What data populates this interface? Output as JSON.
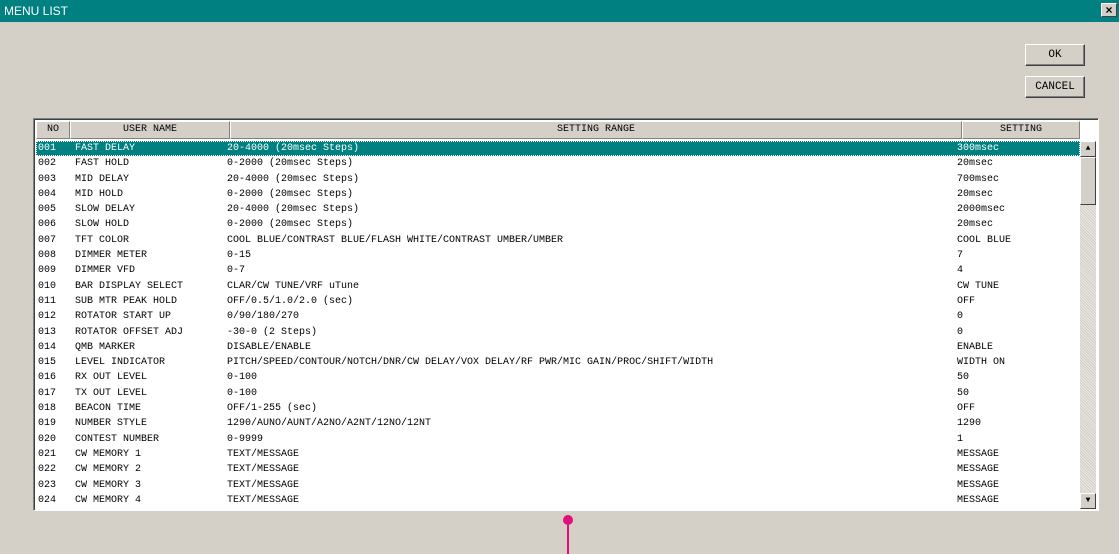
{
  "window": {
    "title": "MENU LIST",
    "close_glyph": "×"
  },
  "buttons": {
    "ok": "OK",
    "cancel": "CANCEL"
  },
  "table": {
    "headers": {
      "no": "NO",
      "name": "USER NAME",
      "range": "SETTING RANGE",
      "setting": "SETTING"
    },
    "rows": [
      {
        "no": "001",
        "name": "FAST DELAY",
        "range": "20-4000 (20msec Steps)",
        "setting": "300msec"
      },
      {
        "no": "002",
        "name": "FAST HOLD",
        "range": "0-2000 (20msec Steps)",
        "setting": "20msec"
      },
      {
        "no": "003",
        "name": "MID DELAY",
        "range": "20-4000 (20msec Steps)",
        "setting": "700msec"
      },
      {
        "no": "004",
        "name": "MID HOLD",
        "range": "0-2000 (20msec Steps)",
        "setting": "20msec"
      },
      {
        "no": "005",
        "name": "SLOW DELAY",
        "range": "20-4000 (20msec Steps)",
        "setting": "2000msec"
      },
      {
        "no": "006",
        "name": "SLOW HOLD",
        "range": "0-2000 (20msec Steps)",
        "setting": "20msec"
      },
      {
        "no": "007",
        "name": "TFT COLOR",
        "range": "COOL BLUE/CONTRAST BLUE/FLASH WHITE/CONTRAST UMBER/UMBER",
        "setting": "COOL BLUE"
      },
      {
        "no": "008",
        "name": "DIMMER METER",
        "range": "0-15",
        "setting": "7"
      },
      {
        "no": "009",
        "name": "DIMMER VFD",
        "range": "0-7",
        "setting": "4"
      },
      {
        "no": "010",
        "name": "BAR DISPLAY SELECT",
        "range": "CLAR/CW TUNE/VRF uTune",
        "setting": "CW TUNE"
      },
      {
        "no": "011",
        "name": "SUB MTR PEAK HOLD",
        "range": "OFF/0.5/1.0/2.0 (sec)",
        "setting": "OFF"
      },
      {
        "no": "012",
        "name": "ROTATOR START UP",
        "range": "0/90/180/270",
        "setting": "0"
      },
      {
        "no": "013",
        "name": "ROTATOR OFFSET ADJ",
        "range": "-30-0 (2 Steps)",
        "setting": "0"
      },
      {
        "no": "014",
        "name": "QMB MARKER",
        "range": "DISABLE/ENABLE",
        "setting": "ENABLE"
      },
      {
        "no": "015",
        "name": "LEVEL INDICATOR",
        "range": "PITCH/SPEED/CONTOUR/NOTCH/DNR/CW DELAY/VOX DELAY/RF PWR/MIC GAIN/PROC/SHIFT/WIDTH",
        "setting": "WIDTH ON"
      },
      {
        "no": "016",
        "name": "RX OUT LEVEL",
        "range": "0-100",
        "setting": "50"
      },
      {
        "no": "017",
        "name": "TX OUT LEVEL",
        "range": "0-100",
        "setting": "50"
      },
      {
        "no": "018",
        "name": "BEACON TIME",
        "range": "OFF/1-255 (sec)",
        "setting": "OFF"
      },
      {
        "no": "019",
        "name": "NUMBER STYLE",
        "range": "1290/AUNO/AUNT/A2NO/A2NT/12NO/12NT",
        "setting": "1290"
      },
      {
        "no": "020",
        "name": "CONTEST NUMBER",
        "range": "0-9999",
        "setting": "1"
      },
      {
        "no": "021",
        "name": "CW MEMORY 1",
        "range": "TEXT/MESSAGE",
        "setting": "MESSAGE"
      },
      {
        "no": "022",
        "name": "CW MEMORY 2",
        "range": "TEXT/MESSAGE",
        "setting": "MESSAGE"
      },
      {
        "no": "023",
        "name": "CW MEMORY 3",
        "range": "TEXT/MESSAGE",
        "setting": "MESSAGE"
      },
      {
        "no": "024",
        "name": "CW MEMORY 4",
        "range": "TEXT/MESSAGE",
        "setting": "MESSAGE"
      }
    ],
    "selected_row": 0
  },
  "scrollbar": {
    "up_glyph": "▲",
    "down_glyph": "▼"
  },
  "colors": {
    "titlebar": "#008080",
    "selection": "#008080",
    "marker": "#e0107a"
  },
  "icons": {
    "marker": "pink-pin-marker-icon"
  }
}
